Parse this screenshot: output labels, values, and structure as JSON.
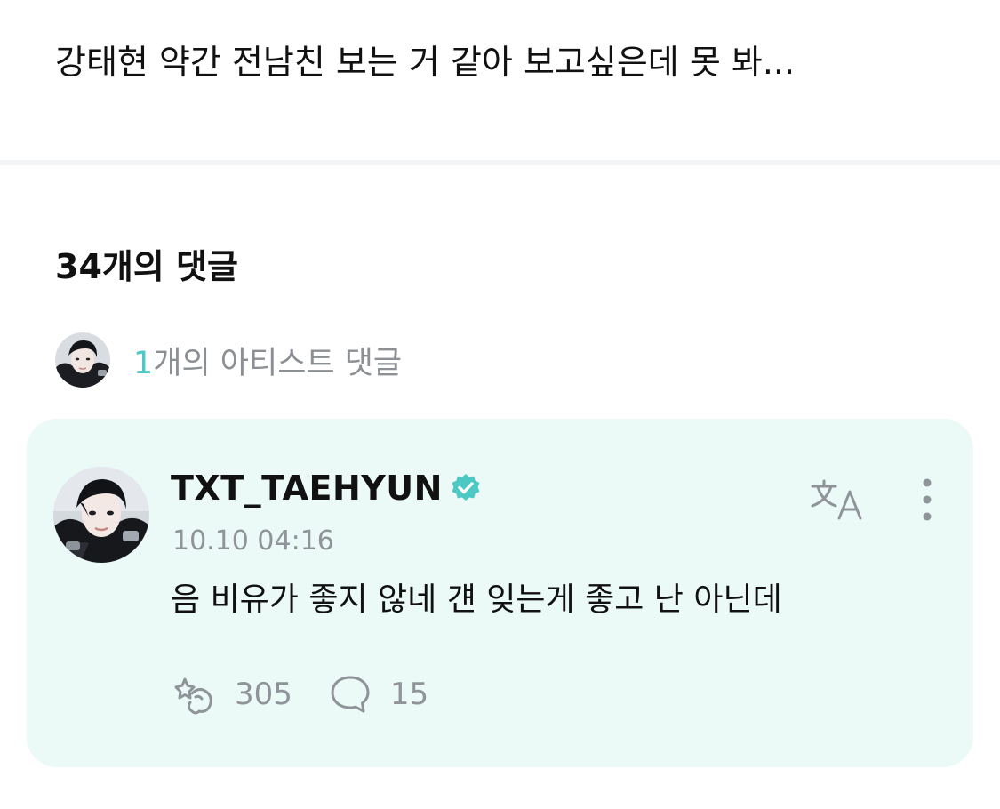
{
  "post": {
    "text": "강태현 약간 전남친 보는 거 같아 보고싶은데 못 봐..."
  },
  "comments_header": {
    "title": "34개의 댓글"
  },
  "artist_comments": {
    "count": "1",
    "label": "개의 아티스트 댓글"
  },
  "comment": {
    "username": "TXT_TAEHYUN",
    "timestamp": "10.10 04:16",
    "text": "음 비유가 좋지 않네 걘 잊는게 좋고 난 아닌데",
    "likes": "305",
    "replies": "15"
  },
  "icons": {
    "verified": "verified-badge-icon",
    "translate": "translate-icon",
    "more": "more-vertical-icon",
    "like": "cheer-hands-icon",
    "reply": "speech-bubble-icon"
  },
  "colors": {
    "accent": "#4cc9c4",
    "card_background": "#ebf9f7",
    "muted_text": "#8f9499"
  }
}
